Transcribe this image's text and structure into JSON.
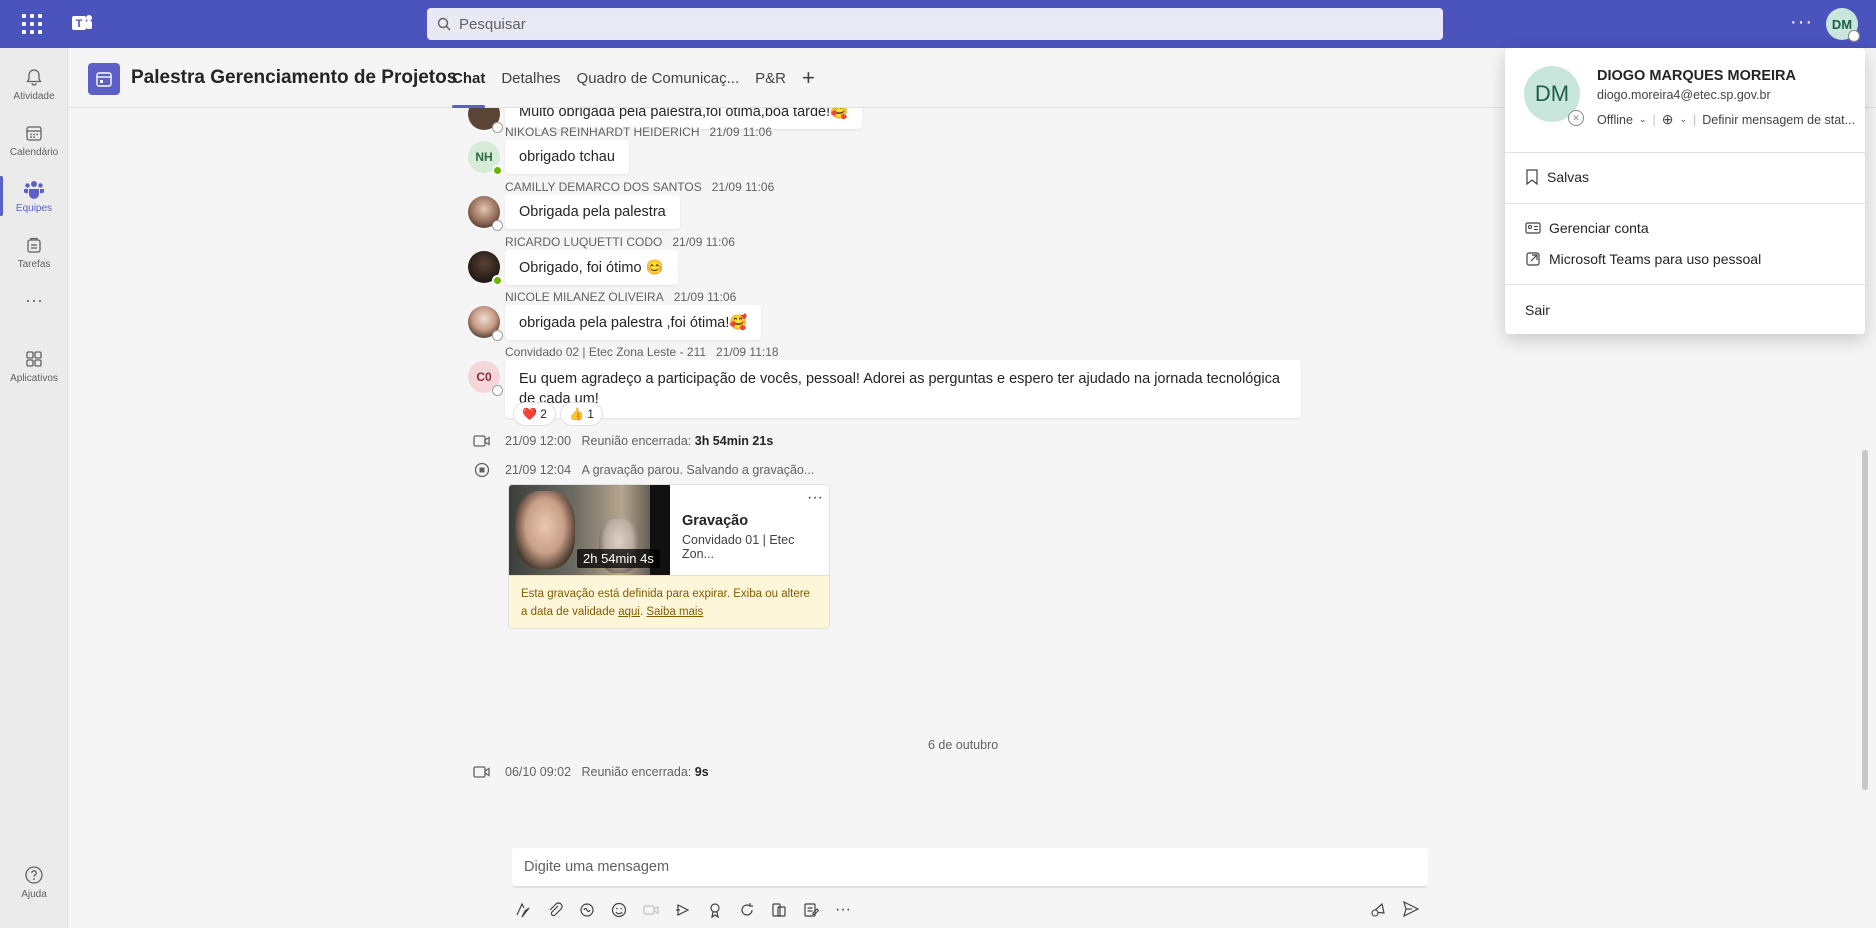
{
  "search": {
    "placeholder": "Pesquisar"
  },
  "topbar": {
    "avatar_initials": "DM",
    "more": "···"
  },
  "rail": [
    {
      "label": "Atividade",
      "icon": "bell-icon"
    },
    {
      "label": "Calendário",
      "icon": "calendar-icon"
    },
    {
      "label": "Equipes",
      "icon": "teams-icon",
      "active": true
    },
    {
      "label": "Tarefas",
      "icon": "tasks-icon"
    },
    {
      "label": "···",
      "icon": "more-icon"
    },
    {
      "label": "Aplicativos",
      "icon": "apps-icon"
    },
    {
      "label": "Ajuda",
      "icon": "help-icon"
    }
  ],
  "header": {
    "title": "Palestra Gerenciamento de Projetos",
    "tabs": [
      "Chat",
      "Detalhes",
      "Quadro de Comunicaç...",
      "P&R"
    ],
    "add": "+"
  },
  "messages": [
    {
      "author": "",
      "time": "",
      "text": "Muito obrigada pela palestra,foi ótima,boa tarde!🥰"
    },
    {
      "author": "NIKOLAS REINHARDT HEIDERICH",
      "time": "21/09 11:06",
      "text": "obrigado tchau",
      "initials": "NH"
    },
    {
      "author": "CAMILLY DEMARCO DOS SANTOS",
      "time": "21/09 11:06",
      "text": "Obrigada pela palestra"
    },
    {
      "author": "RICARDO LUQUETTI CODO",
      "time": "21/09 11:06",
      "text": "Obrigado, foi ótimo 😊"
    },
    {
      "author": "NICOLE MILANEZ OLIVEIRA",
      "time": "21/09 11:06",
      "text": "obrigada pela palestra ,foi ótima!🥰"
    },
    {
      "author": "Convidado 02 | Etec Zona Leste - 211",
      "time": "21/09 11:18",
      "text": "Eu quem agradeço a participação de vocês, pessoal! Adorei as perguntas e espero ter ajudado na jornada tecnológica de cada um!",
      "initials": "C0"
    }
  ],
  "reactions": [
    {
      "emoji": "❤️",
      "count": "2"
    },
    {
      "emoji": "👍",
      "count": "1"
    }
  ],
  "system": {
    "meeting_end_1": {
      "time": "21/09 12:00",
      "text": "Reunião encerrada:",
      "duration": "3h 54min 21s"
    },
    "recording_stop": {
      "time": "21/09 12:04",
      "text": "A gravação parou. Salvando a gravação..."
    },
    "meeting_end_2": {
      "time": "06/10 09:02",
      "text": "Reunião encerrada:",
      "duration": "9s"
    }
  },
  "recording": {
    "duration": "2h 54min 4s",
    "title": "Gravação",
    "subtitle": "Convidado 01 | Etec Zon...",
    "more": "···",
    "warning_text": "Esta gravação está definida para expirar. Exiba ou altere a data de validade",
    "link_here": "aqui",
    "link_more": "Saiba mais"
  },
  "date_separator": "6 de outubro",
  "compose": {
    "placeholder": "Digite uma mensagem"
  },
  "profile": {
    "initials": "DM",
    "name": "DIOGO MARQUES MOREIRA",
    "email": "diogo.moreira4@etec.sp.gov.br",
    "status": "Offline",
    "set_status": "Definir mensagem de stat...",
    "saved": "Salvas",
    "manage": "Gerenciar conta",
    "personal": "Microsoft Teams para uso pessoal",
    "signout": "Sair"
  },
  "colors": {
    "brand": "#4b53bc",
    "accent": "#5b5fc7",
    "online": "#6bb700"
  }
}
